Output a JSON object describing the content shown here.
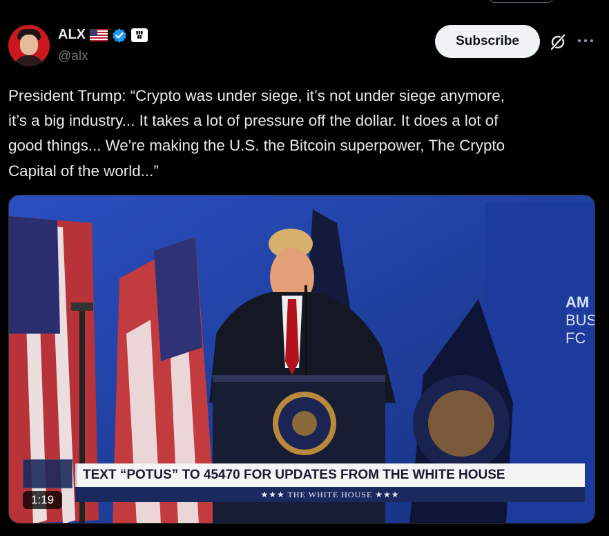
{
  "author": {
    "name": "ALX",
    "handle": "@alx",
    "verified": true
  },
  "actions": {
    "subscribe_label": "Subscribe",
    "grok_icon": "grok-icon",
    "more_icon": "more-icon"
  },
  "tweet": {
    "text": "President Trump: “Crypto was under siege, it’s not under siege anymore,\nit’s a big industry... It takes a lot of pressure off the dollar. It does a lot of\ngood things... We're making the U.S. the Bitcoin superpower, The Crypto\nCapital of the world...”"
  },
  "video": {
    "duration": "1:19",
    "banner_text": "TEXT “POTUS” TO 45470 FOR UPDATES FROM THE WHITE HOUSE",
    "banner_subtext": "★★★  THE WHITE HOUSE  ★★★",
    "backdrop_text": [
      "AM",
      "BUS",
      "FC"
    ]
  },
  "colors": {
    "background": "#000000",
    "text": "#e7e9ea",
    "muted": "#71767b",
    "verified_blue": "#1d9bf0",
    "stage_blue": "#1f3fa8"
  }
}
